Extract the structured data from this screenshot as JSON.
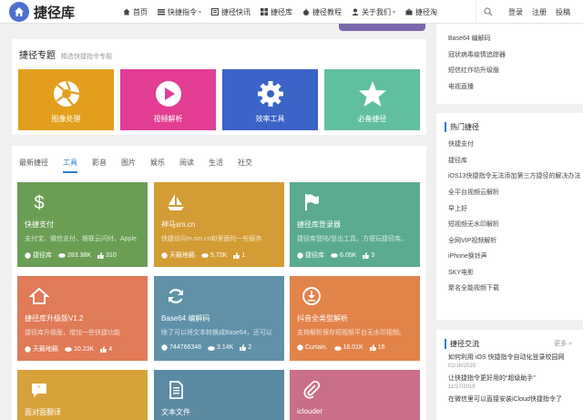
{
  "brand": {
    "name": "捷径库",
    "logo_color": "#4f6fcf"
  },
  "nav": {
    "items": [
      {
        "label": "首页",
        "icon": "home-icon"
      },
      {
        "label": "快捷指令",
        "icon": "list-icon",
        "caret": "▾"
      },
      {
        "label": "捷径快讯",
        "icon": "news-icon"
      },
      {
        "label": "捷径库",
        "icon": "grid-icon"
      },
      {
        "label": "捷径教程",
        "icon": "apple-icon"
      },
      {
        "label": "关于我们",
        "icon": "user-icon",
        "caret": "▾"
      },
      {
        "label": "捷径淘",
        "icon": "shop-icon"
      }
    ]
  },
  "auth": {
    "login": "登录",
    "register": "注册",
    "contribute": "投稿"
  },
  "topics": {
    "title": "捷径专题",
    "subtitle": "精选快捷指令专题",
    "items": [
      {
        "label": "图像处理",
        "icon": "aperture-icon",
        "color": "#e39f1c"
      },
      {
        "label": "视频解析",
        "icon": "play-icon",
        "color": "#e23d92"
      },
      {
        "label": "效率工具",
        "icon": "gear-icon",
        "color": "#3b63c8"
      },
      {
        "label": "必备捷径",
        "icon": "star-icon",
        "color": "#5fbfa0"
      }
    ]
  },
  "tabs": [
    "最新捷径",
    "工具",
    "影音",
    "图片",
    "娱乐",
    "阅读",
    "生活",
    "社交"
  ],
  "cards": [
    {
      "title": "快捷支付",
      "desc": "支付宝、微信支付、银联云闪付、Apple",
      "author": "捷径库",
      "views": "283.38K",
      "likes": "310",
      "color": "#6a9e55",
      "icon": "dollar-icon"
    },
    {
      "title": "神马sm.cn",
      "desc": "快捷访问m.sm.cn和里面的一些服务",
      "author": "天籁地籁",
      "views": "5.72K",
      "likes": "1",
      "color": "#d39c35",
      "icon": "boat-icon"
    },
    {
      "title": "捷径库登录器",
      "desc": "捷径库登陆/登出工具，方便玩捷径库。",
      "author": "捷径库",
      "views": "6.05K",
      "likes": "3",
      "color": "#5aab8e",
      "icon": "flag-icon"
    },
    {
      "title": "捷径库升级版V1.2",
      "desc": "捷径库升级版，增加一些快捷功能",
      "author": "天籁地籁",
      "views": "10.23K",
      "likes": "4",
      "color": "#e07a57",
      "icon": "house-icon"
    },
    {
      "title": "Base64 编解码",
      "desc": "除了可以将文本转换成Base64，还可以",
      "author": "744766348",
      "views": "3.14K",
      "likes": "2",
      "color": "#6191a8",
      "icon": "refresh-icon"
    },
    {
      "title": "抖音全类型解析",
      "desc": "支持解析保存短视频平台无水印视频。",
      "author": "Curtain.",
      "views": "16.01K",
      "likes": "16",
      "color": "#e2834a",
      "icon": "download-icon"
    },
    {
      "title": "面对面翻译",
      "desc": "",
      "author": "",
      "views": "",
      "likes": "",
      "color": "#d7a23a",
      "icon": "chat-icon"
    },
    {
      "title": "文本文件",
      "desc": "",
      "author": "",
      "views": "",
      "likes": "",
      "color": "#5b8aa3",
      "icon": "file-icon"
    },
    {
      "title": "iclouder",
      "desc": "",
      "author": "",
      "views": "",
      "likes": "",
      "color": "#c96f88",
      "icon": "clip-icon"
    }
  ],
  "side_top": {
    "items": [
      "Base64 编解码",
      "冠状病毒疫情追踪器",
      "短信红作坊升级版",
      "电视直播"
    ]
  },
  "side_hot": {
    "title": "热门捷径",
    "items": [
      "快捷支付",
      "捷径库",
      "iOS13快捷指令无法添加第三方捷径的解决办法",
      "全平台视频云解析",
      "早上好",
      "短视频无水印解析",
      "全网VIP视频解析",
      "iPhone换铃声",
      "SKY电影",
      "聚名全能视频下载"
    ]
  },
  "side_talk": {
    "title": "捷径交流",
    "more": "更多 »",
    "items": [
      {
        "title": "如何利用 iOS 快捷指令自动化登录校园网",
        "date": "01/16/2020"
      },
      {
        "title": "让快捷指令更好用的“超级助手”",
        "date": "11/27/2019"
      },
      {
        "title": "在微信里可以直接安装iCloud快捷指令了",
        "date": ""
      }
    ]
  }
}
